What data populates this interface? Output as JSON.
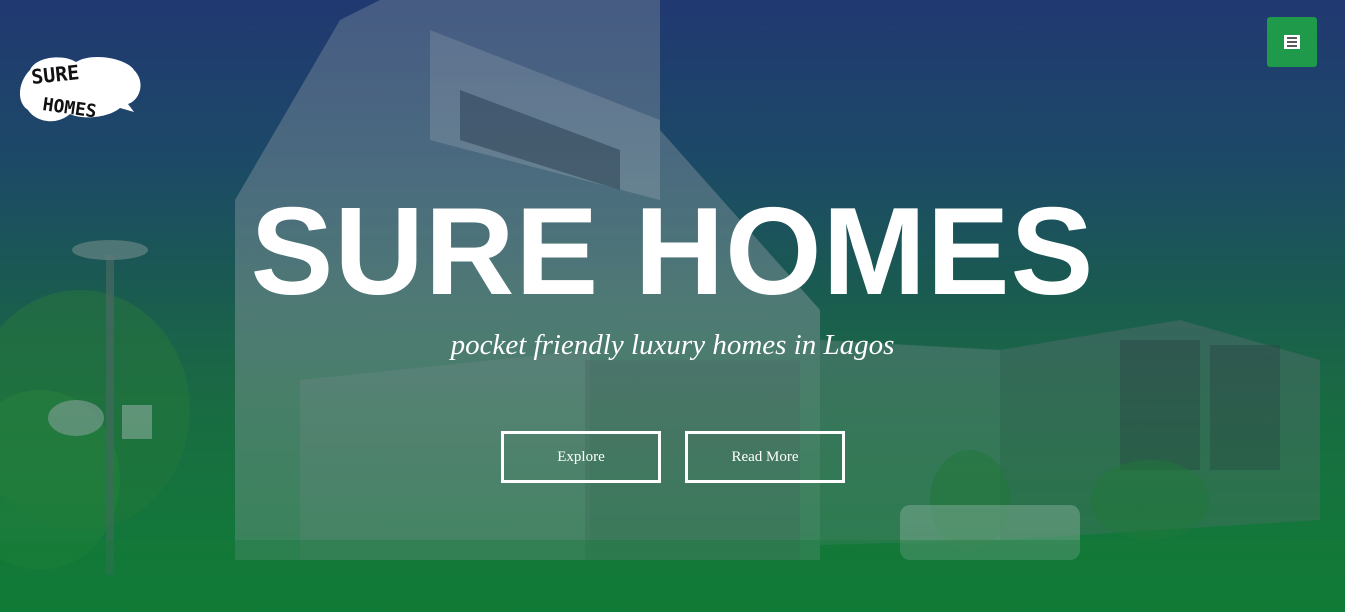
{
  "brand": {
    "logo_alt": "SURE HOMES logo",
    "logo_text_top": "SURE",
    "logo_text_bottom": "HOMES"
  },
  "header": {
    "menu_icon": "hamburger-menu-icon"
  },
  "hero": {
    "title": "SURE HOMES",
    "tagline": "pocket friendly luxury homes in Lagos",
    "buttons": [
      {
        "label": "Explore"
      },
      {
        "label": "Read More"
      }
    ]
  },
  "colors": {
    "accent": "#1e9a4a",
    "overlay_top": "#223a6e",
    "overlay_bottom": "#147f3a",
    "text": "#ffffff"
  }
}
